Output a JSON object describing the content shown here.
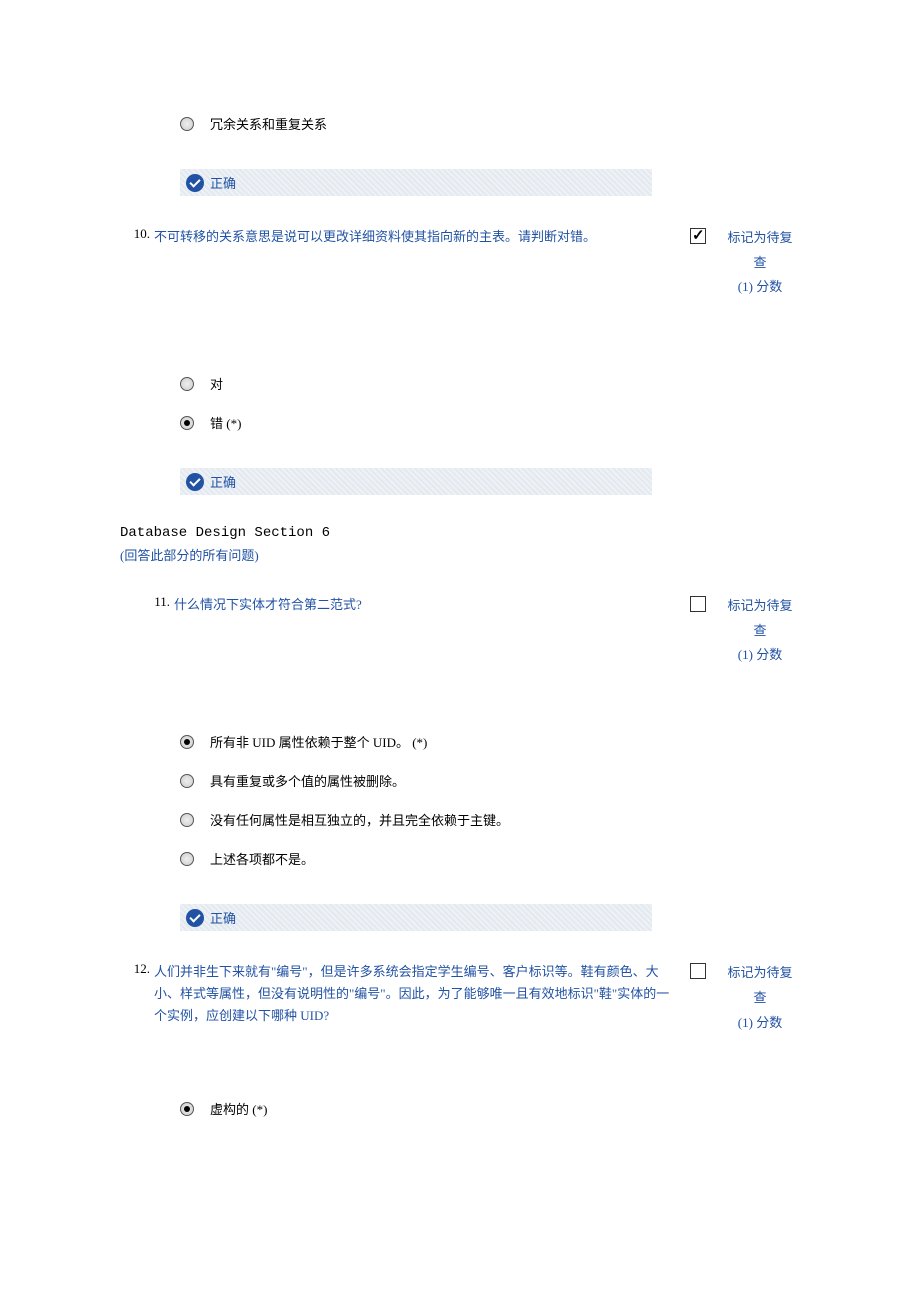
{
  "prev_option": {
    "text": "冗余关系和重复关系",
    "selected": false
  },
  "correct_label": "正确",
  "mark_review_line1": "标记为待复",
  "mark_review_line2": "查",
  "mark_review_line3": "(1) 分数",
  "q10": {
    "number": "10.",
    "text": "不可转移的关系意思是说可以更改详细资料使其指向新的主表。请判断对错。",
    "checked": true,
    "options": [
      {
        "text": "对",
        "selected": false
      },
      {
        "text": "错 (*)",
        "selected": true
      }
    ]
  },
  "section": {
    "title": "Database Design Section 6",
    "sub": "(回答此部分的所有问题)"
  },
  "q11": {
    "number": "11.",
    "text": "什么情况下实体才符合第二范式?",
    "checked": false,
    "options": [
      {
        "text": "所有非 UID 属性依赖于整个 UID。 (*)",
        "selected": true
      },
      {
        "text": "具有重复或多个值的属性被删除。",
        "selected": false
      },
      {
        "text": "没有任何属性是相互独立的，并且完全依赖于主键。",
        "selected": false
      },
      {
        "text": "上述各项都不是。",
        "selected": false
      }
    ]
  },
  "q12": {
    "number": "12.",
    "text": "人们并非生下来就有\"编号\"，但是许多系统会指定学生编号、客户标识等。鞋有颜色、大小、样式等属性，但没有说明性的\"编号\"。因此，为了能够唯一且有效地标识\"鞋\"实体的一个实例，应创建以下哪种 UID?",
    "checked": false,
    "options": [
      {
        "text": "虚构的 (*)",
        "selected": true
      }
    ]
  }
}
